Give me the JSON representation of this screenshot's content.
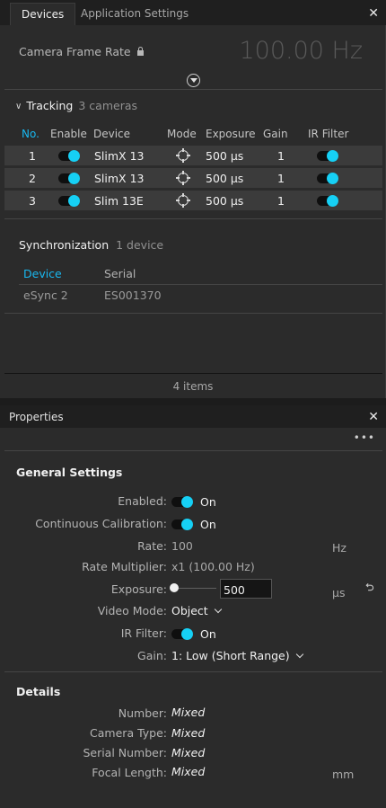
{
  "devices_panel": {
    "tabs": [
      {
        "label": "Devices",
        "active": true
      },
      {
        "label": "Application Settings",
        "active": false
      }
    ],
    "close_glyph": "✕",
    "frame_rate": {
      "label": "Camera Frame Rate",
      "value": "100.00 Hz",
      "locked": true
    },
    "tracking": {
      "title": "Tracking",
      "count": "3 cameras",
      "columns": [
        "No.",
        "Enable",
        "Device",
        "Mode",
        "Exposure",
        "Gain",
        "IR Filter"
      ],
      "rows": [
        {
          "no": "1",
          "enabled": true,
          "device": "SlimX 13",
          "mode_icon": "crosshair-icon",
          "exposure": "500 µs",
          "gain": "1",
          "ir_filter": true
        },
        {
          "no": "2",
          "enabled": true,
          "device": "SlimX 13",
          "mode_icon": "crosshair-icon",
          "exposure": "500 µs",
          "gain": "1",
          "ir_filter": true
        },
        {
          "no": "3",
          "enabled": true,
          "device": "Slim 13E",
          "mode_icon": "crosshair-icon",
          "exposure": "500 µs",
          "gain": "1",
          "ir_filter": true
        }
      ]
    },
    "synchronization": {
      "title": "Synchronization",
      "count": "1 device",
      "columns": [
        "Device",
        "Serial"
      ],
      "rows": [
        {
          "device": "eSync 2",
          "serial": "ES001370"
        }
      ]
    },
    "footer": "4 items"
  },
  "properties_panel": {
    "title": "Properties",
    "close_glyph": "✕",
    "more_glyph": "•••",
    "general": {
      "title": "General Settings",
      "enabled": {
        "label": "Enabled:",
        "value": "On"
      },
      "continuous_calibration": {
        "label": "Continuous Calibration:",
        "value": "On"
      },
      "rate": {
        "label": "Rate:",
        "value": "100",
        "unit": "Hz"
      },
      "rate_multiplier": {
        "label": "Rate Multiplier:",
        "value": "x1 (100.00 Hz)"
      },
      "exposure": {
        "label": "Exposure:",
        "value": "500",
        "unit": "µs",
        "slider_level": 0.0
      },
      "video_mode": {
        "label": "Video Mode:",
        "value": "Object"
      },
      "ir_filter": {
        "label": "IR Filter:",
        "value": "On"
      },
      "gain": {
        "label": "Gain:",
        "value": "1: Low (Short Range)"
      }
    },
    "details": {
      "title": "Details",
      "number": {
        "label": "Number:",
        "value": "Mixed"
      },
      "camera_type": {
        "label": "Camera Type:",
        "value": "Mixed"
      },
      "serial_number": {
        "label": "Serial Number:",
        "value": "Mixed"
      },
      "focal_length": {
        "label": "Focal Length:",
        "value": "Mixed",
        "unit": "mm"
      }
    }
  },
  "colors": {
    "accent": "#19b8f0",
    "toggle_on": "#16d0f5",
    "panel_bg": "#2b2b2b",
    "row_bg": "#3b3b3b"
  }
}
